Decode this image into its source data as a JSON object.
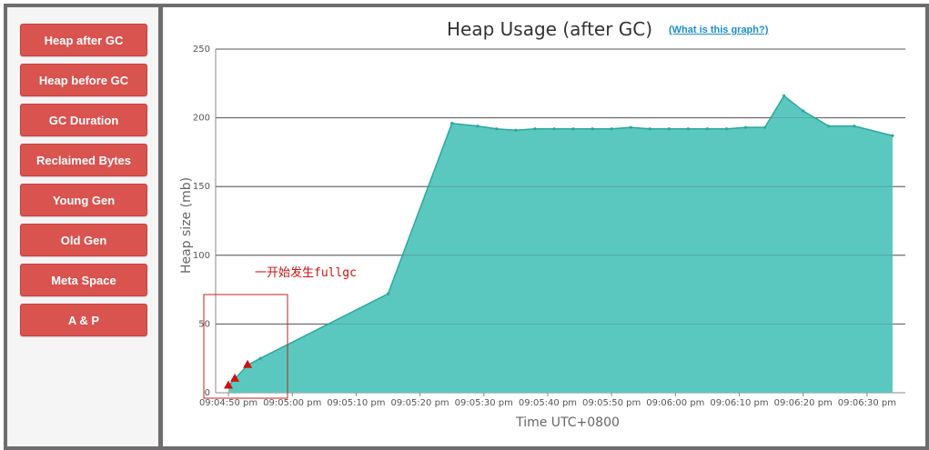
{
  "sidebar": {
    "items": [
      {
        "label": "Heap after GC"
      },
      {
        "label": "Heap before GC"
      },
      {
        "label": "GC Duration"
      },
      {
        "label": "Reclaimed Bytes"
      },
      {
        "label": "Young Gen"
      },
      {
        "label": "Old Gen"
      },
      {
        "label": "Meta Space"
      },
      {
        "label": "A & P"
      }
    ]
  },
  "header": {
    "title": "Heap Usage (after GC)",
    "help_link": "(What is this graph?)"
  },
  "colors": {
    "button": "#d9534f",
    "area_fill": "#5bc8c0",
    "area_line": "#2aa79b",
    "annotation": "#d01010"
  },
  "chart_data": {
    "type": "area",
    "title": "Heap Usage (after GC)",
    "xlabel": "Time UTC+0800",
    "ylabel": "Heap size (mb)",
    "ylim": [
      0,
      250
    ],
    "yticks": [
      0,
      50,
      100,
      150,
      200,
      250
    ],
    "xlim": [
      "09:04:48",
      "09:06:36"
    ],
    "xticks": [
      "09:04:50 pm",
      "09:05:00 pm",
      "09:05:10 pm",
      "09:05:20 pm",
      "09:05:30 pm",
      "09:05:40 pm",
      "09:05:50 pm",
      "09:06:00 pm",
      "09:06:10 pm",
      "09:06:20 pm",
      "09:06:30 pm"
    ],
    "grid": true,
    "series": [
      {
        "x": [
          "09:04:50",
          "09:04:51",
          "09:04:53",
          "09:04:55",
          "09:05:15",
          "09:05:25",
          "09:05:29",
          "09:05:32",
          "09:05:35",
          "09:05:38",
          "09:05:41",
          "09:05:44",
          "09:05:47",
          "09:05:50",
          "09:05:53",
          "09:05:56",
          "09:05:59",
          "09:06:02",
          "09:06:05",
          "09:06:08",
          "09:06:11",
          "09:06:14",
          "09:06:17",
          "09:06:20",
          "09:06:24",
          "09:06:28",
          "09:06:34"
        ],
        "y": [
          5,
          10,
          20,
          25,
          72,
          196,
          194,
          192,
          191,
          192,
          192,
          192,
          192,
          192,
          193,
          192,
          192,
          192,
          192,
          192,
          193,
          193,
          216,
          205,
          194,
          194,
          187
        ]
      }
    ],
    "fullgc_markers": [
      "09:04:50",
      "09:04:51",
      "09:04:53"
    ],
    "annotation": "一开始发生fullgc"
  }
}
